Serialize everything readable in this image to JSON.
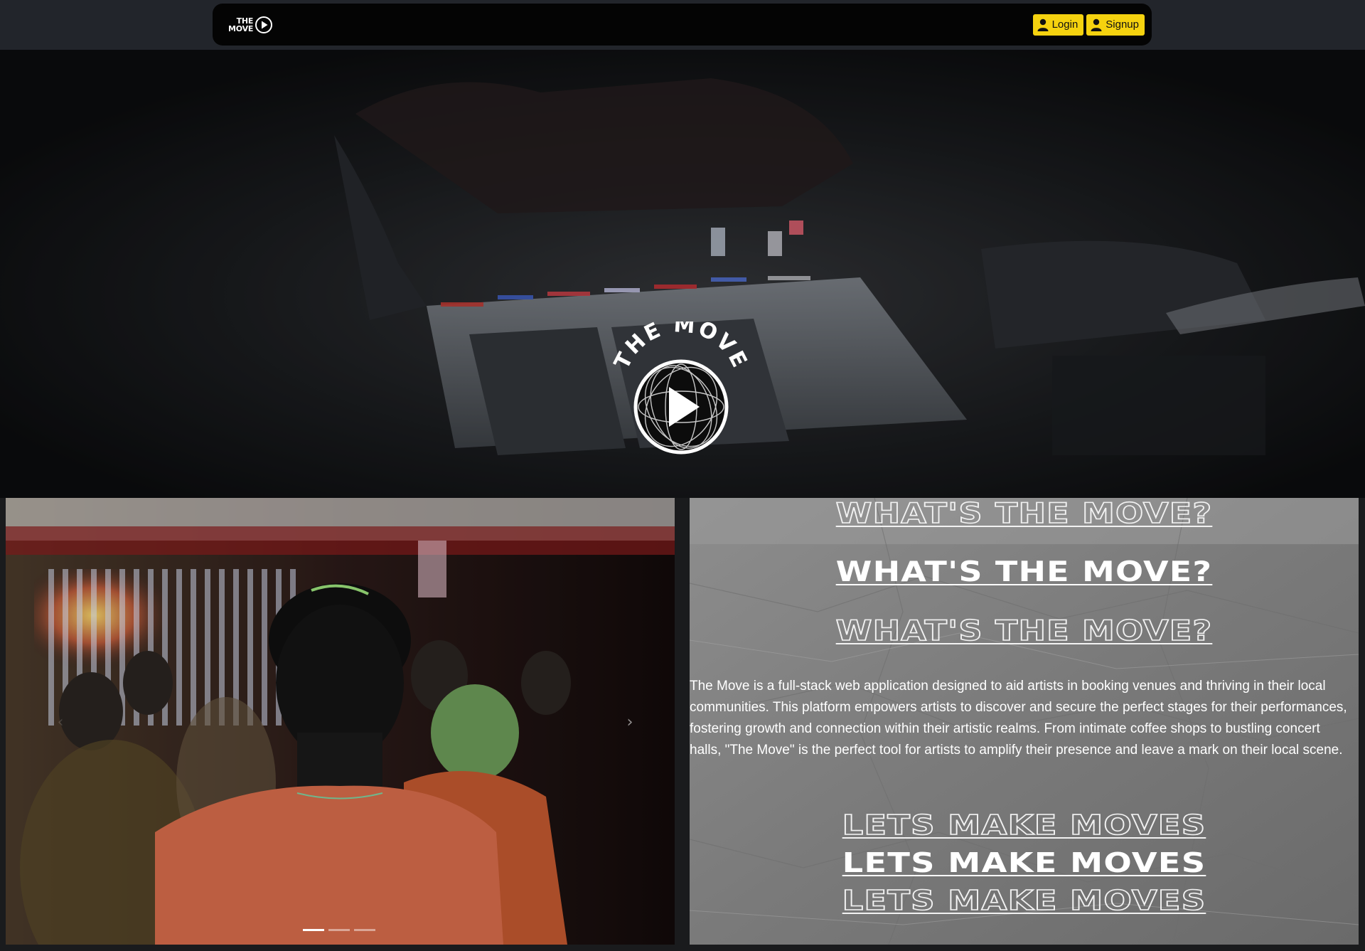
{
  "nav": {
    "brand_line1": "THE",
    "brand_line2": "MOVE",
    "login_label": "Login",
    "signup_label": "Signup"
  },
  "hero": {
    "logo_text": "THE MOVE"
  },
  "carousel": {
    "prev_icon": "chevron-left-icon",
    "next_icon": "chevron-right-icon",
    "slide_count": 3,
    "active_slide": 1
  },
  "about": {
    "heading_move": "WHAT'S THE MOVE?",
    "description": "The Move is a full-stack web application designed to aid artists in booking venues and thriving in their local communities. This platform empowers artists to discover and secure the perfect stages for their performances, fostering growth and connection within their artistic realms. From intimate coffee shops to bustling concert halls, \"The Move\" is the perfect tool for artists to amplify their presence and leave a mark on their local scene.",
    "heading_lets": "LETS MAKE MOVES"
  },
  "colors": {
    "accent": "#f5d20f",
    "navbar": "#040404",
    "page_bg": "#1f2126",
    "about_bg": "#858585"
  }
}
